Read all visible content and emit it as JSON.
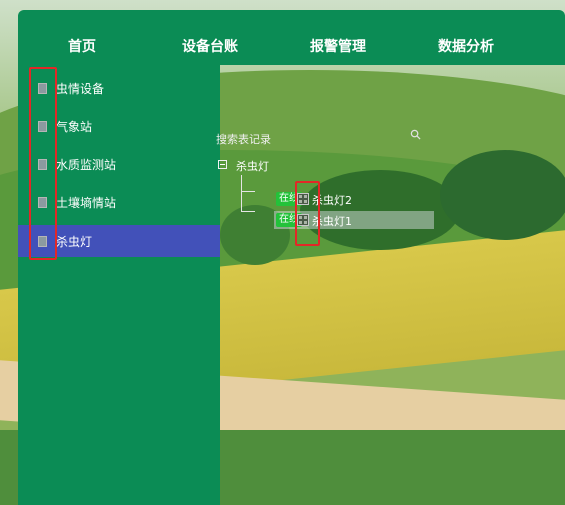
{
  "nav": {
    "items": [
      {
        "label": "首页"
      },
      {
        "label": "设备台账"
      },
      {
        "label": "报警管理"
      },
      {
        "label": "数据分析"
      }
    ]
  },
  "sidebar": {
    "items": [
      {
        "label": "虫情设备",
        "icon": "device-icon"
      },
      {
        "label": "气象站",
        "icon": "device-icon"
      },
      {
        "label": "水质监测站",
        "icon": "device-icon"
      },
      {
        "label": "土壤墒情站",
        "icon": "device-icon"
      },
      {
        "label": "杀虫灯",
        "icon": "device-icon",
        "active": true
      }
    ]
  },
  "search": {
    "placeholder": "搜索表记录",
    "icon": "search-icon"
  },
  "tree": {
    "root": {
      "label": "杀虫灯",
      "expanded": true
    },
    "children": [
      {
        "status": "在线",
        "label": "杀虫灯2",
        "icon": "device-icon"
      },
      {
        "status": "在线",
        "label": "杀虫灯1",
        "icon": "device-icon",
        "selected": true
      }
    ]
  },
  "colors": {
    "primary_green": "#0b8c55",
    "active_blue": "#4251b9",
    "status_green": "#23c23a",
    "highlight_red": "#e32727"
  }
}
